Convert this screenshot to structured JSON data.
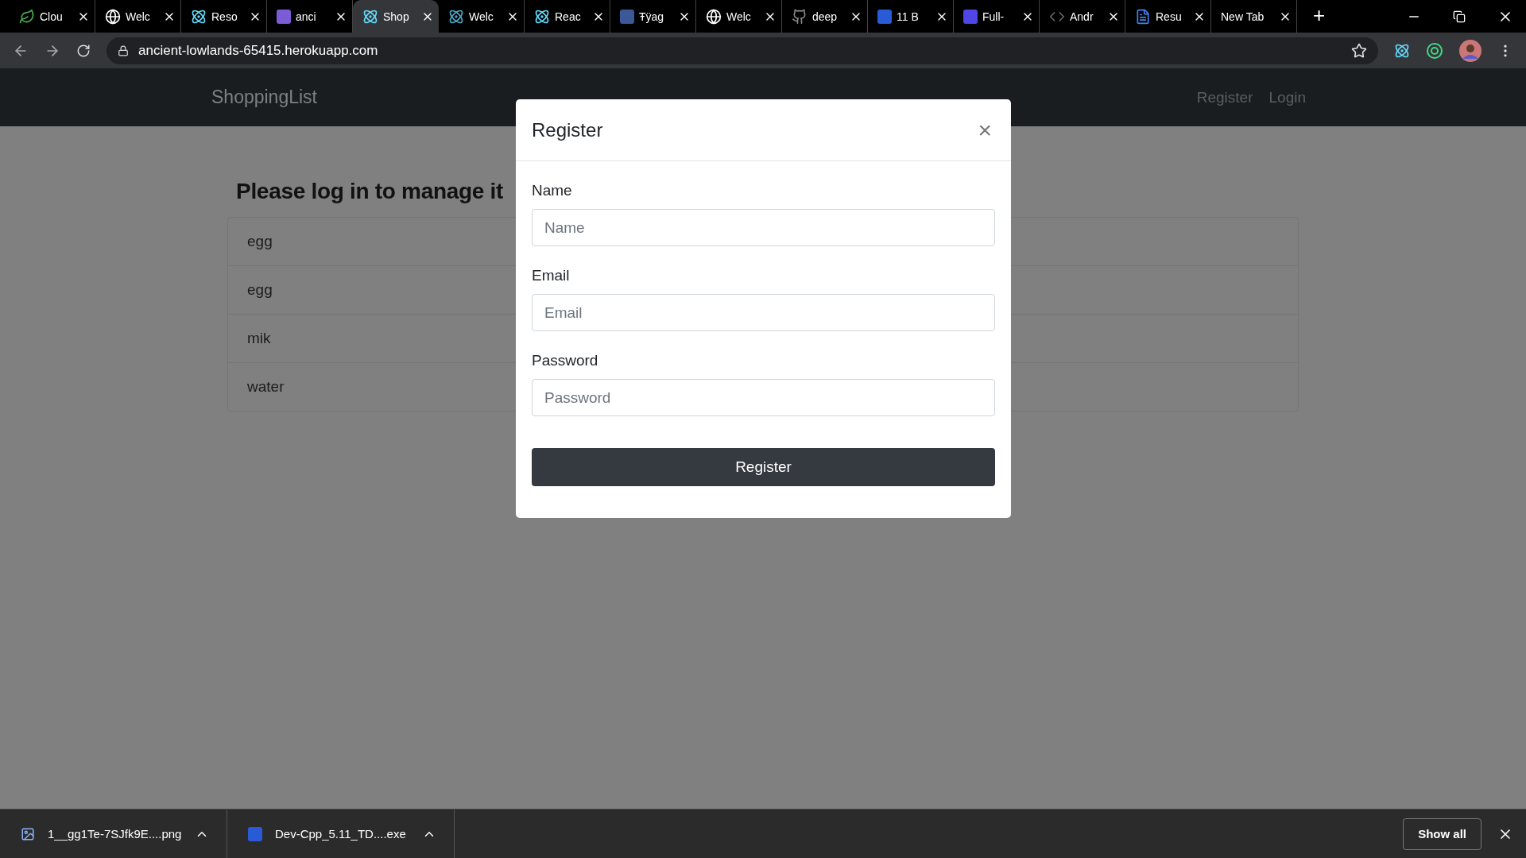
{
  "browser": {
    "tabs": [
      {
        "kind": "leaf",
        "title": "Clou",
        "selected": false
      },
      {
        "kind": "globe",
        "title": "Welc",
        "selected": false
      },
      {
        "kind": "atom",
        "title": "Reso",
        "selected": false
      },
      {
        "kind": "purple",
        "title": "anci",
        "selected": false
      },
      {
        "kind": "atom",
        "title": "Shop",
        "selected": true
      },
      {
        "kind": "atom-dark",
        "title": "Welc",
        "selected": false
      },
      {
        "kind": "atom",
        "title": "Reac",
        "selected": false
      },
      {
        "kind": "facebook",
        "title": "Ŧÿag",
        "selected": false
      },
      {
        "kind": "globe",
        "title": "Welc",
        "selected": false
      },
      {
        "kind": "github",
        "title": "deep",
        "selected": false
      },
      {
        "kind": "blue",
        "title": "11 B",
        "selected": false
      },
      {
        "kind": "indigo",
        "title": "Full-",
        "selected": false
      },
      {
        "kind": "code",
        "title": "Andr",
        "selected": false
      },
      {
        "kind": "doc",
        "title": "Resu",
        "selected": false
      },
      {
        "kind": "none",
        "title": "New Tab",
        "selected": false
      }
    ],
    "new_tab": "+",
    "url": "ancient-lowlands-65415.herokuapp.com"
  },
  "navbar": {
    "brand": "ShoppingList",
    "links": [
      "Register",
      "Login"
    ]
  },
  "page": {
    "heading": "Please log in to manage it",
    "items": [
      "egg",
      "egg",
      "mik",
      "water"
    ]
  },
  "modal": {
    "title": "Register",
    "close": "×",
    "fields": [
      {
        "label": "Name",
        "placeholder": "Name"
      },
      {
        "label": "Email",
        "placeholder": "Email"
      },
      {
        "label": "Password",
        "placeholder": "Password"
      }
    ],
    "submit": "Register"
  },
  "downloads": {
    "items": [
      {
        "kind": "image",
        "name": "1__gg1Te-7SJfk9E....png"
      },
      {
        "kind": "exe",
        "name": "Dev-Cpp_5.11_TD....exe"
      }
    ],
    "show_all": "Show all"
  }
}
